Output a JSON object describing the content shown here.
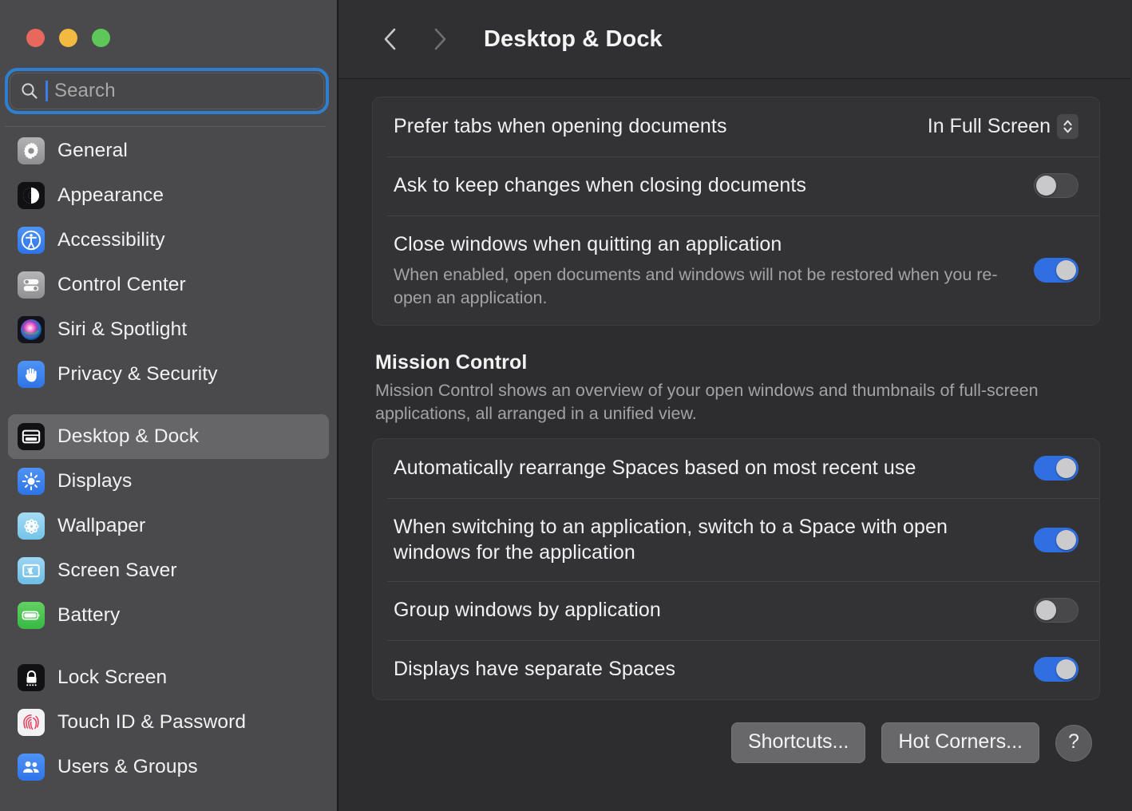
{
  "window": {
    "traffic_lights": [
      {
        "name": "close",
        "color": "#e8685e"
      },
      {
        "name": "minimize",
        "color": "#f2ba40"
      },
      {
        "name": "maximize",
        "color": "#5ec75a"
      }
    ]
  },
  "search": {
    "placeholder": "Search",
    "value": "",
    "icon": "search-icon",
    "focused": true
  },
  "sidebar": {
    "groups": [
      {
        "items": [
          {
            "label": "General",
            "icon": "gear-icon"
          },
          {
            "label": "Appearance",
            "icon": "appearance-contrast-icon"
          },
          {
            "label": "Accessibility",
            "icon": "accessibility-person-icon"
          },
          {
            "label": "Control Center",
            "icon": "control-center-sliders-icon"
          },
          {
            "label": "Siri & Spotlight",
            "icon": "siri-orb-icon"
          },
          {
            "label": "Privacy & Security",
            "icon": "privacy-hand-icon"
          }
        ]
      },
      {
        "items": [
          {
            "label": "Desktop & Dock",
            "icon": "desktop-dock-icon",
            "selected": true
          },
          {
            "label": "Displays",
            "icon": "displays-brightness-icon"
          },
          {
            "label": "Wallpaper",
            "icon": "wallpaper-flower-icon"
          },
          {
            "label": "Screen Saver",
            "icon": "screen-saver-moon-icon"
          },
          {
            "label": "Battery",
            "icon": "battery-icon"
          }
        ]
      },
      {
        "items": [
          {
            "label": "Lock Screen",
            "icon": "lock-icon"
          },
          {
            "label": "Touch ID & Password",
            "icon": "touch-id-fingerprint-icon"
          },
          {
            "label": "Users & Groups",
            "icon": "users-groups-icon"
          }
        ]
      }
    ]
  },
  "toolbar": {
    "title": "Desktop & Dock",
    "back_icon": "chevron-left-icon",
    "forward_icon": "chevron-right-icon",
    "back_enabled": true,
    "forward_enabled": false
  },
  "main": {
    "card_windows": {
      "rows": [
        {
          "label": "Prefer tabs when opening documents",
          "control": "popup",
          "value": "In Full Screen",
          "chevron_icon": "chevron-up-down-icon"
        },
        {
          "label": "Ask to keep changes when closing documents",
          "control": "toggle",
          "toggle_on": false
        },
        {
          "label": "Close windows when quitting an application",
          "description": "When enabled, open documents and windows will not be restored when you re-open an application.",
          "control": "toggle",
          "toggle_on": true
        }
      ]
    },
    "section_mission_control": {
      "title": "Mission Control",
      "description": "Mission Control shows an overview of your open windows and thumbnails of full-screen applications, all arranged in a unified view."
    },
    "card_mission_control": {
      "rows": [
        {
          "label": "Automatically rearrange Spaces based on most recent use",
          "control": "toggle",
          "toggle_on": true
        },
        {
          "label": "When switching to an application, switch to a Space with open windows for the application",
          "control": "toggle",
          "toggle_on": true
        },
        {
          "label": "Group windows by application",
          "control": "toggle",
          "toggle_on": false
        },
        {
          "label": "Displays have separate Spaces",
          "control": "toggle",
          "toggle_on": true
        }
      ]
    },
    "buttons": {
      "shortcuts": "Shortcuts...",
      "hot_corners": "Hot Corners...",
      "help": "?"
    }
  },
  "colors": {
    "accent_blue": "#2f6fe0",
    "focus_ring": "#2f7fd0",
    "sidebar_bg": "#4a4a4c",
    "content_bg": "#2d2d2f",
    "card_bg": "#333335",
    "text_primary": "#f1f1f2",
    "text_secondary": "#a3a3a5"
  }
}
